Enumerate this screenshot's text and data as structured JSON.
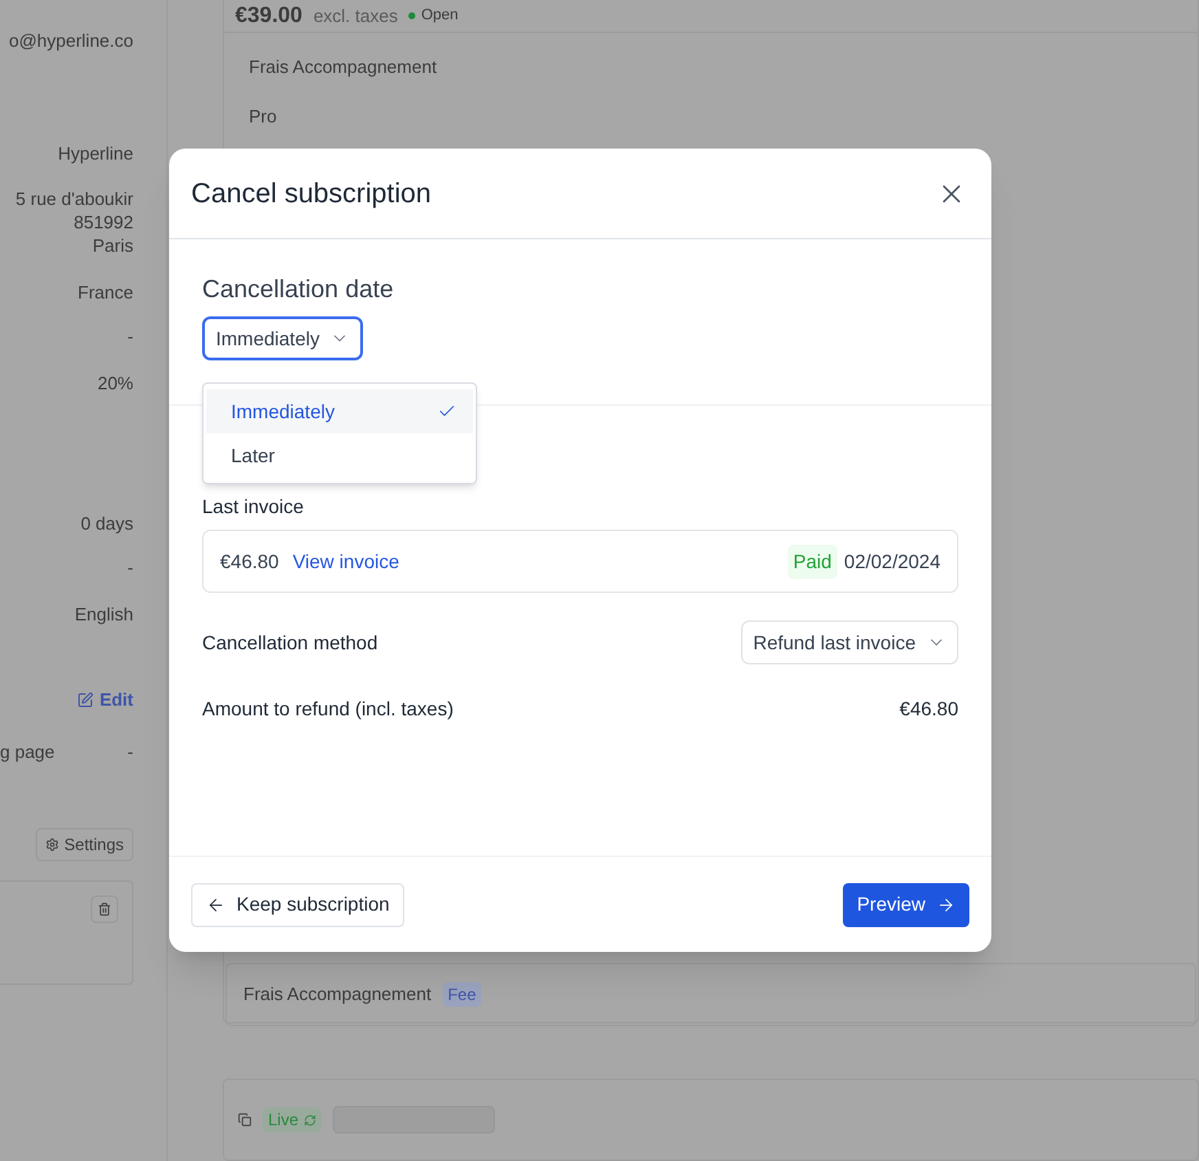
{
  "background": {
    "details": [
      {
        "value": "o@hyperline.co"
      },
      {
        "value": "Hyperline"
      },
      {
        "value": "5 rue d'aboukir"
      },
      {
        "value": "851992"
      },
      {
        "value": "Paris"
      },
      {
        "value": "France"
      },
      {
        "value": "-"
      },
      {
        "value": "20%"
      },
      {
        "value": "0 days"
      },
      {
        "value": "-"
      },
      {
        "value": "English"
      }
    ],
    "edit_link": "Edit",
    "checkout_row": {
      "label": "g page",
      "value": "-"
    },
    "settings_button": "Settings",
    "subscription": {
      "price": "€39.00",
      "price_note": "excl. taxes",
      "status": "Open",
      "lines": [
        "Frais Accompagnement",
        "Pro"
      ]
    },
    "product": {
      "name": "Frais Accompagnement",
      "tag": "Fee"
    },
    "next_subscription": {
      "status": "Live"
    }
  },
  "dialog": {
    "title": "Cancel subscription",
    "date_section": {
      "label": "Cancellation date",
      "value": "Immediately",
      "open": true,
      "options": [
        {
          "label": "Immediately",
          "selected": true
        },
        {
          "label": "Later",
          "selected": false
        }
      ]
    },
    "last_invoice": {
      "label": "Last invoice",
      "amount": "€46.80",
      "link": "View invoice",
      "status": "Paid",
      "date": "02/02/2024"
    },
    "method": {
      "label": "Cancellation method",
      "value": "Refund last invoice"
    },
    "refund": {
      "label": "Amount to refund (incl. taxes)",
      "amount": "€46.80"
    },
    "back_button": "Keep subscription",
    "next_button": "Preview"
  }
}
